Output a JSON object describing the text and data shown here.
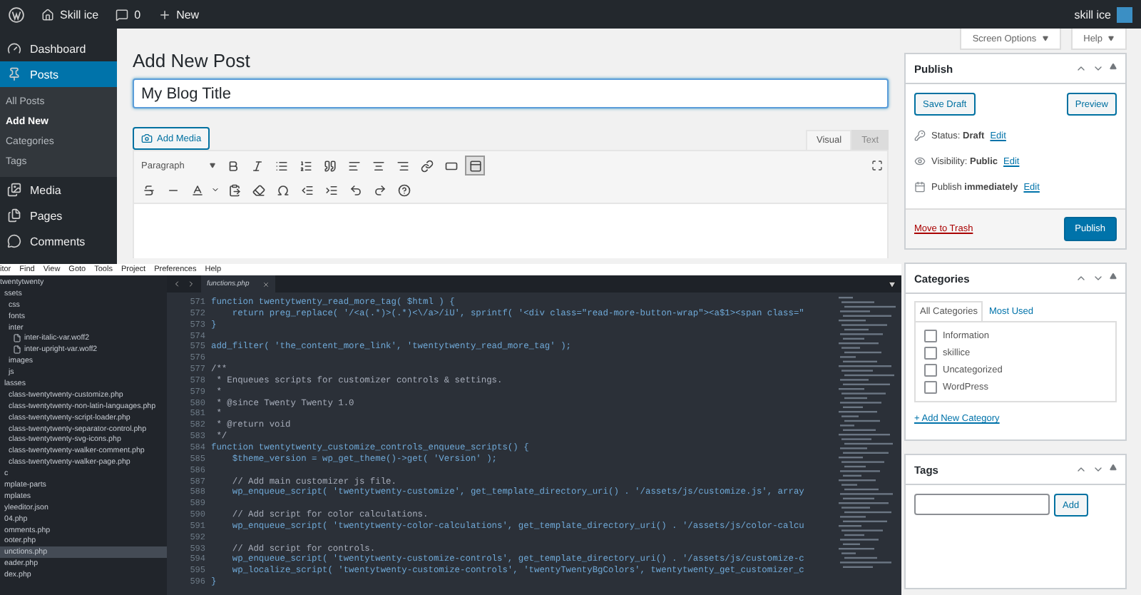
{
  "admin_bar": {
    "site": "Skill ice",
    "comments": "0",
    "new": "New",
    "user": "skill ice"
  },
  "sidebar": {
    "items": [
      {
        "kind": "dashboard",
        "label": "Dashboard",
        "selected": false
      },
      {
        "kind": "posts",
        "label": "Posts",
        "selected": true,
        "children": [
          {
            "label": "All Posts",
            "selected": false
          },
          {
            "label": "Add New",
            "selected": true
          },
          {
            "label": "Categories",
            "selected": false
          },
          {
            "label": "Tags",
            "selected": false
          }
        ]
      },
      {
        "kind": "media",
        "label": "Media",
        "selected": false
      },
      {
        "kind": "pages",
        "label": "Pages",
        "selected": false
      },
      {
        "kind": "comments",
        "label": "Comments",
        "selected": false
      }
    ]
  },
  "header_buttons": [
    {
      "label": "Screen Options"
    },
    {
      "label": "Help"
    }
  ],
  "page_title": "Add New Post",
  "title_field": {
    "value": "My Blog Title"
  },
  "add_media": "Add Media",
  "editor_tabs": [
    {
      "label": "Visual",
      "selected": true
    },
    {
      "label": "Text",
      "selected": false
    }
  ],
  "toolbar": {
    "format": "Paragraph",
    "row_1": [
      {
        "kind": "bold",
        "pressed": false
      },
      {
        "kind": "italic",
        "pressed": false
      },
      {
        "kind": "bullet-list",
        "pressed": false
      },
      {
        "kind": "numbered-list",
        "pressed": false
      },
      {
        "kind": "quote",
        "pressed": false
      },
      {
        "kind": "align-left",
        "pressed": false
      },
      {
        "kind": "align-center",
        "pressed": false
      },
      {
        "kind": "align-right",
        "pressed": false
      },
      {
        "kind": "link",
        "pressed": false
      },
      {
        "kind": "read-more",
        "pressed": false
      },
      {
        "kind": "toolbar-toggle",
        "pressed": true
      }
    ],
    "row_2": [
      {
        "kind": "strikethrough",
        "pressed": false
      },
      {
        "kind": "horizontal-line",
        "pressed": false
      },
      {
        "kind": "text-color",
        "pressed": false
      },
      {
        "kind": "paste-text",
        "pressed": false
      },
      {
        "kind": "clear-formatting",
        "pressed": false
      },
      {
        "kind": "special-character",
        "pressed": false
      },
      {
        "kind": "outdent",
        "pressed": false
      },
      {
        "kind": "indent",
        "pressed": false
      },
      {
        "kind": "undo",
        "pressed": false
      },
      {
        "kind": "redo",
        "pressed": false
      },
      {
        "kind": "help",
        "pressed": false
      }
    ]
  },
  "publish": {
    "title": "Publish",
    "save_draft": "Save Draft",
    "preview": "Preview",
    "rows": [
      {
        "kind": "status",
        "label": "Status:",
        "value": "Draft",
        "link": "Edit"
      },
      {
        "kind": "visibility",
        "label": "Visibility:",
        "value": "Public",
        "link": "Edit"
      },
      {
        "kind": "schedule",
        "label": "Publish",
        "value": "immediately",
        "link": "Edit"
      }
    ],
    "trash": "Move to Trash",
    "publish": "Publish"
  },
  "categories": {
    "title": "Categories",
    "tabs": [
      {
        "label": "All Categories",
        "selected": true
      },
      {
        "label": "Most Used",
        "selected": false
      }
    ],
    "items": [
      {
        "label": "Information",
        "checked": false
      },
      {
        "label": "skillice",
        "checked": false
      },
      {
        "label": "Uncategorized",
        "checked": false
      },
      {
        "label": "WordPress",
        "checked": false
      }
    ],
    "add_link": "+ Add New Category"
  },
  "tags": {
    "title": "Tags",
    "add": "Add"
  },
  "code_editor": {
    "menu": [
      "itor",
      "Find",
      "View",
      "Goto",
      "Tools",
      "Project",
      "Preferences",
      "Help"
    ],
    "file_tree": [
      {
        "kind": "entry",
        "label": "twentytwenty",
        "selected": false,
        "children": [
          {
            "kind": "entry",
            "label": "ssets",
            "selected": false,
            "children": [
              {
                "kind": "entry",
                "label": "css",
                "selected": false
              },
              {
                "kind": "entry",
                "label": "fonts",
                "selected": false
              },
              {
                "kind": "entry",
                "label": "inter",
                "selected": false,
                "children": [
                  {
                    "kind": "icon-file",
                    "label": "inter-italic-var.woff2",
                    "selected": false
                  },
                  {
                    "kind": "icon-file",
                    "label": "inter-upright-var.woff2",
                    "selected": false
                  }
                ]
              },
              {
                "kind": "entry",
                "label": "images",
                "selected": false
              },
              {
                "kind": "entry",
                "label": "js",
                "selected": false
              }
            ]
          },
          {
            "kind": "entry",
            "label": "lasses",
            "selected": false,
            "children": [
              {
                "kind": "entry",
                "label": "class-twentytwenty-customize.php",
                "selected": false
              },
              {
                "kind": "entry",
                "label": "class-twentytwenty-non-latin-languages.php",
                "selected": false
              },
              {
                "kind": "entry",
                "label": "class-twentytwenty-script-loader.php",
                "selected": false
              },
              {
                "kind": "entry",
                "label": "class-twentytwenty-separator-control.php",
                "selected": false
              },
              {
                "kind": "entry",
                "label": "class-twentytwenty-svg-icons.php",
                "selected": false
              },
              {
                "kind": "entry",
                "label": "class-twentytwenty-walker-comment.php",
                "selected": false
              },
              {
                "kind": "entry",
                "label": "class-twentytwenty-walker-page.php",
                "selected": false
              }
            ]
          },
          {
            "kind": "entry",
            "label": "c",
            "selected": false
          },
          {
            "kind": "entry",
            "label": "mplate-parts",
            "selected": false
          },
          {
            "kind": "entry",
            "label": "mplates",
            "selected": false
          },
          {
            "kind": "entry",
            "label": "yleeditor.json",
            "selected": false
          },
          {
            "kind": "entry",
            "label": "04.php",
            "selected": false
          },
          {
            "kind": "entry",
            "label": "omments.php",
            "selected": false
          },
          {
            "kind": "entry",
            "label": "ooter.php",
            "selected": false
          },
          {
            "kind": "entry",
            "label": "unctions.php",
            "selected": true
          },
          {
            "kind": "entry",
            "label": "eader.php",
            "selected": false
          },
          {
            "kind": "entry",
            "label": "dex.php",
            "selected": false
          }
        ]
      }
    ],
    "tab": "functions.php",
    "lines": [
      {
        "number": "571",
        "kind": "code",
        "text": "function twentytwenty_read_more_tag( $html ) {"
      },
      {
        "number": "572",
        "kind": "code",
        "text": "    return preg_replace( '/<a(.*)>(.*)<\\/a>/iU', sprintf( '<div class=\"read-more-button-wrap\"><a$1><span class=\""
      },
      {
        "number": "573",
        "kind": "code",
        "text": "}"
      },
      {
        "number": "574",
        "kind": "blank"
      },
      {
        "number": "575",
        "kind": "code",
        "text": "add_filter( 'the_content_more_link', 'twentytwenty_read_more_tag' );"
      },
      {
        "number": "576",
        "kind": "blank"
      },
      {
        "number": "577",
        "kind": "comment",
        "text": "/**"
      },
      {
        "number": "578",
        "kind": "comment",
        "text": " * Enqueues scripts for customizer controls & settings."
      },
      {
        "number": "579",
        "kind": "comment",
        "text": " *"
      },
      {
        "number": "580",
        "kind": "comment",
        "text": " * @since Twenty Twenty 1.0"
      },
      {
        "number": "581",
        "kind": "comment",
        "text": " *"
      },
      {
        "number": "582",
        "kind": "comment",
        "text": " * @return void"
      },
      {
        "number": "583",
        "kind": "comment",
        "text": " */"
      },
      {
        "number": "584",
        "kind": "code",
        "text": "function twentytwenty_customize_controls_enqueue_scripts() {"
      },
      {
        "number": "585",
        "kind": "code",
        "text": "    $theme_version = wp_get_theme()->get( 'Version' );"
      },
      {
        "number": "586",
        "kind": "blank"
      },
      {
        "number": "587",
        "kind": "comment",
        "text": "    // Add main customizer js file."
      },
      {
        "number": "588",
        "kind": "code",
        "text": "    wp_enqueue_script( 'twentytwenty-customize', get_template_directory_uri() . '/assets/js/customize.js', array"
      },
      {
        "number": "589",
        "kind": "blank"
      },
      {
        "number": "590",
        "kind": "comment",
        "text": "    // Add script for color calculations."
      },
      {
        "number": "591",
        "kind": "code",
        "text": "    wp_enqueue_script( 'twentytwenty-color-calculations', get_template_directory_uri() . '/assets/js/color-calcu"
      },
      {
        "number": "592",
        "kind": "blank"
      },
      {
        "number": "593",
        "kind": "comment",
        "text": "    // Add script for controls."
      },
      {
        "number": "594",
        "kind": "code",
        "text": "    wp_enqueue_script( 'twentytwenty-customize-controls', get_template_directory_uri() . '/assets/js/customize-c"
      },
      {
        "number": "595",
        "kind": "code",
        "text": "    wp_localize_script( 'twentytwenty-customize-controls', 'twentyTwentyBgColors', twentytwenty_get_customizer_c"
      },
      {
        "number": "596",
        "kind": "code",
        "text": "}"
      }
    ]
  }
}
